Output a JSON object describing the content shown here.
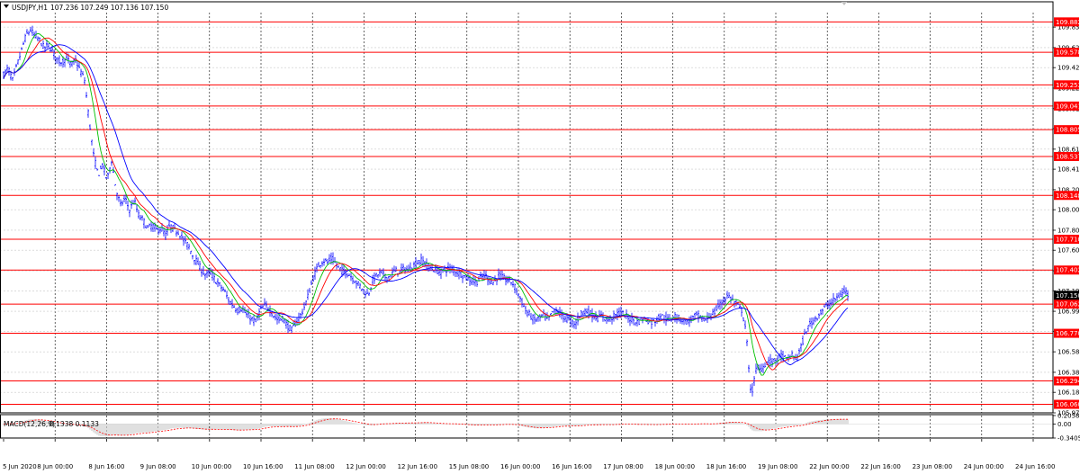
{
  "header": {
    "symbol_label": "USDJPY,H1",
    "ohlc_text": "107.236 107.249 107.136 107.150"
  },
  "macd_label": {
    "title": "MACD(12,26,9)",
    "values": "0.1338 0.1133"
  },
  "colors": {
    "price_bars": "#1a1aff",
    "ma_fast": "#00c000",
    "ma_mid": "#ff0000",
    "ma_slow": "#0000ff",
    "levels": "#ff0000",
    "macd_hist": "#c0c0c0",
    "macd_signal": "#ff0000",
    "grid": "#c8c8c8"
  },
  "current_price": "107.150",
  "chart_data": [
    {
      "type": "candlestick",
      "title": "USDJPY,H1",
      "ylim": [
        105.975,
        109.975
      ],
      "grid": true,
      "y_ticks": [
        "109.830",
        "109.625",
        "109.425",
        "109.220",
        "109.015",
        "108.815",
        "108.610",
        "108.410",
        "108.205",
        "108.005",
        "107.800",
        "107.600",
        "107.395",
        "107.195",
        "106.990",
        "106.790",
        "106.585",
        "106.380",
        "106.180",
        "105.975"
      ],
      "x_ticks": [
        "5 Jun 2020",
        "8 Jun 00:00",
        "8 Jun 16:00",
        "9 Jun 08:00",
        "10 Jun 00:00",
        "10 Jun 16:00",
        "11 Jun 08:00",
        "12 Jun 00:00",
        "12 Jun 16:00",
        "15 Jun 08:00",
        "16 Jun 00:00",
        "16 Jun 16:00",
        "17 Jun 08:00",
        "18 Jun 00:00",
        "18 Jun 16:00",
        "19 Jun 08:00",
        "22 Jun 00:00",
        "22 Jun 16:00",
        "23 Jun 08:00",
        "24 Jun 00:00",
        "24 Jun 16:00"
      ],
      "levels": [
        "109.882",
        "109.578",
        "109.253",
        "109.041",
        "108.805",
        "108.537",
        "108.148",
        "107.710",
        "107.402",
        "107.062",
        "106.770",
        "106.294",
        "106.060"
      ],
      "close_path": [
        [
          0,
          109.35
        ],
        [
          5,
          109.42
        ],
        [
          10,
          109.3
        ],
        [
          15,
          109.45
        ],
        [
          20,
          109.6
        ],
        [
          25,
          109.75
        ],
        [
          30,
          109.8
        ],
        [
          35,
          109.74
        ],
        [
          40,
          109.7
        ],
        [
          45,
          109.62
        ],
        [
          50,
          109.65
        ],
        [
          55,
          109.58
        ],
        [
          60,
          109.5
        ],
        [
          65,
          109.48
        ],
        [
          70,
          109.52
        ],
        [
          75,
          109.45
        ],
        [
          80,
          109.5
        ],
        [
          85,
          109.4
        ],
        [
          90,
          109.3
        ],
        [
          95,
          108.9
        ],
        [
          100,
          108.55
        ],
        [
          105,
          108.35
        ],
        [
          110,
          108.45
        ],
        [
          115,
          108.3
        ],
        [
          120,
          108.5
        ],
        [
          125,
          108.2
        ],
        [
          130,
          108.05
        ],
        [
          135,
          108.12
        ],
        [
          140,
          108.0
        ],
        [
          145,
          108.1
        ],
        [
          150,
          107.95
        ],
        [
          155,
          107.9
        ],
        [
          160,
          107.82
        ],
        [
          165,
          107.85
        ],
        [
          170,
          107.8
        ],
        [
          175,
          107.82
        ],
        [
          180,
          107.75
        ],
        [
          185,
          107.85
        ],
        [
          190,
          107.8
        ],
        [
          195,
          107.78
        ],
        [
          200,
          107.7
        ],
        [
          205,
          107.65
        ],
        [
          210,
          107.55
        ],
        [
          215,
          107.48
        ],
        [
          220,
          107.4
        ],
        [
          225,
          107.35
        ],
        [
          230,
          107.38
        ],
        [
          235,
          107.3
        ],
        [
          240,
          107.25
        ],
        [
          245,
          107.2
        ],
        [
          250,
          107.1
        ],
        [
          255,
          107.05
        ],
        [
          260,
          107.0
        ],
        [
          265,
          107.02
        ],
        [
          270,
          106.95
        ],
        [
          275,
          106.92
        ],
        [
          280,
          106.88
        ],
        [
          285,
          107.0
        ],
        [
          290,
          107.05
        ],
        [
          295,
          107.02
        ],
        [
          300,
          106.95
        ],
        [
          305,
          106.9
        ],
        [
          310,
          106.92
        ],
        [
          315,
          106.85
        ],
        [
          320,
          106.8
        ],
        [
          325,
          106.88
        ],
        [
          330,
          106.95
        ],
        [
          335,
          107.05
        ],
        [
          340,
          107.2
        ],
        [
          345,
          107.35
        ],
        [
          350,
          107.45
        ],
        [
          355,
          107.5
        ],
        [
          360,
          107.48
        ],
        [
          365,
          107.52
        ],
        [
          370,
          107.45
        ],
        [
          375,
          107.4
        ],
        [
          380,
          107.38
        ],
        [
          385,
          107.35
        ],
        [
          390,
          107.3
        ],
        [
          395,
          107.25
        ],
        [
          400,
          107.2
        ],
        [
          405,
          107.15
        ],
        [
          410,
          107.3
        ],
        [
          415,
          107.35
        ],
        [
          420,
          107.38
        ],
        [
          425,
          107.32
        ],
        [
          430,
          107.35
        ],
        [
          435,
          107.4
        ],
        [
          440,
          107.38
        ],
        [
          445,
          107.42
        ],
        [
          450,
          107.4
        ],
        [
          455,
          107.45
        ],
        [
          460,
          107.48
        ],
        [
          465,
          107.5
        ],
        [
          470,
          107.45
        ],
        [
          475,
          107.42
        ],
        [
          480,
          107.4
        ],
        [
          485,
          107.38
        ],
        [
          490,
          107.4
        ],
        [
          495,
          107.42
        ],
        [
          500,
          107.4
        ],
        [
          505,
          107.38
        ],
        [
          510,
          107.35
        ],
        [
          515,
          107.32
        ],
        [
          520,
          107.3
        ],
        [
          525,
          107.28
        ],
        [
          530,
          107.32
        ],
        [
          535,
          107.35
        ],
        [
          540,
          107.3
        ],
        [
          545,
          107.28
        ],
        [
          550,
          107.35
        ],
        [
          555,
          107.32
        ],
        [
          560,
          107.3
        ],
        [
          565,
          107.28
        ],
        [
          570,
          107.2
        ],
        [
          575,
          107.1
        ],
        [
          580,
          107.0
        ],
        [
          585,
          106.95
        ],
        [
          590,
          106.9
        ],
        [
          595,
          106.92
        ],
        [
          600,
          106.95
        ],
        [
          605,
          106.9
        ],
        [
          610,
          106.98
        ],
        [
          615,
          107.0
        ],
        [
          620,
          106.95
        ],
        [
          625,
          106.92
        ],
        [
          630,
          106.9
        ],
        [
          635,
          106.85
        ],
        [
          640,
          106.95
        ],
        [
          645,
          107.0
        ],
        [
          650,
          106.98
        ],
        [
          655,
          106.95
        ],
        [
          660,
          106.92
        ],
        [
          665,
          106.95
        ],
        [
          670,
          106.9
        ],
        [
          675,
          106.92
        ],
        [
          680,
          106.95
        ],
        [
          685,
          106.98
        ],
        [
          690,
          106.95
        ],
        [
          695,
          106.92
        ],
        [
          700,
          106.9
        ],
        [
          705,
          106.88
        ],
        [
          710,
          106.92
        ],
        [
          715,
          106.9
        ],
        [
          720,
          106.88
        ],
        [
          725,
          106.9
        ],
        [
          730,
          106.95
        ],
        [
          735,
          106.92
        ],
        [
          740,
          106.9
        ],
        [
          745,
          106.95
        ],
        [
          750,
          106.92
        ],
        [
          755,
          106.9
        ],
        [
          760,
          106.88
        ],
        [
          765,
          106.92
        ],
        [
          770,
          106.95
        ],
        [
          775,
          106.92
        ],
        [
          780,
          106.9
        ],
        [
          785,
          106.95
        ],
        [
          790,
          106.98
        ],
        [
          795,
          107.05
        ],
        [
          800,
          107.1
        ],
        [
          805,
          107.15
        ],
        [
          810,
          107.1
        ],
        [
          815,
          107.05
        ],
        [
          820,
          107.0
        ],
        [
          825,
          106.8
        ],
        [
          828,
          106.4
        ],
        [
          831,
          106.15
        ],
        [
          834,
          106.3
        ],
        [
          837,
          106.45
        ],
        [
          840,
          106.4
        ],
        [
          845,
          106.45
        ],
        [
          850,
          106.5
        ],
        [
          855,
          106.48
        ],
        [
          860,
          106.52
        ],
        [
          865,
          106.55
        ],
        [
          870,
          106.5
        ],
        [
          875,
          106.55
        ],
        [
          880,
          106.52
        ],
        [
          885,
          106.6
        ],
        [
          890,
          106.75
        ],
        [
          895,
          106.85
        ],
        [
          900,
          106.9
        ],
        [
          905,
          106.95
        ],
        [
          910,
          107.0
        ],
        [
          915,
          107.05
        ],
        [
          920,
          107.08
        ],
        [
          925,
          107.12
        ],
        [
          930,
          107.15
        ],
        [
          935,
          107.2
        ],
        [
          938,
          107.15
        ]
      ]
    },
    {
      "type": "bar",
      "title": "MACD(12,26,9)",
      "ylim": [
        -0.3405,
        0.2058
      ],
      "y_ticks": [
        "0.2058",
        "0.00",
        "-0.3405"
      ]
    }
  ]
}
